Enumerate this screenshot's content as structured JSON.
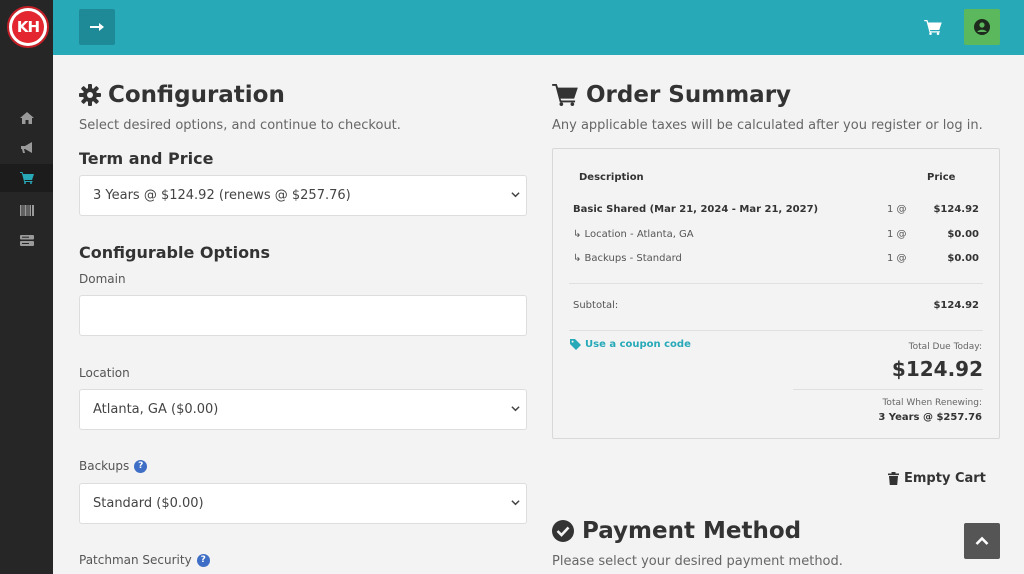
{
  "logo": {
    "text": "KH"
  },
  "sidebar": {
    "items": [
      {
        "icon": "home-icon"
      },
      {
        "icon": "megaphone-icon"
      },
      {
        "icon": "cart-icon",
        "active": true
      },
      {
        "icon": "barcode-icon"
      },
      {
        "icon": "server-icon"
      }
    ]
  },
  "colors": {
    "accent": "#27a9b8",
    "sidebar": "#262626",
    "user_button": "#5cb85c",
    "help": "#3f6ec6"
  },
  "config": {
    "title": "Configuration",
    "subtitle": "Select desired options, and continue to checkout.",
    "term_label": "Term and Price",
    "term_value": "3 Years @ $124.92 (renews @ $257.76)",
    "options_title": "Configurable Options",
    "domain_label": "Domain",
    "domain_value": "",
    "location_label": "Location",
    "location_value": "Atlanta, GA ($0.00)",
    "backups_label": "Backups",
    "backups_value": "Standard ($0.00)",
    "patchman_label": "Patchman Security"
  },
  "order": {
    "title": "Order Summary",
    "subtitle": "Any applicable taxes will be calculated after you register or log in.",
    "col_description": "Description",
    "col_price": "Price",
    "rows": [
      {
        "desc": "Basic Shared (Mar 21, 2024 - Mar 21, 2027)",
        "qty": "1 @",
        "price": "$124.92"
      },
      {
        "desc": "↳ Location - Atlanta, GA",
        "qty": "1 @",
        "price": "$0.00"
      },
      {
        "desc": "↳ Backups - Standard",
        "qty": "1 @",
        "price": "$0.00"
      }
    ],
    "subtotal_label": "Subtotal:",
    "subtotal_value": "$124.92",
    "coupon_label": "Use a coupon code",
    "total_today_label": "Total Due Today:",
    "total_today_value": "$124.92",
    "renewing_label": "Total When Renewing:",
    "renewing_value": "3 Years @ $257.76",
    "empty_cart": "Empty Cart"
  },
  "payment": {
    "title": "Payment Method",
    "subtitle": "Please select your desired payment method."
  }
}
